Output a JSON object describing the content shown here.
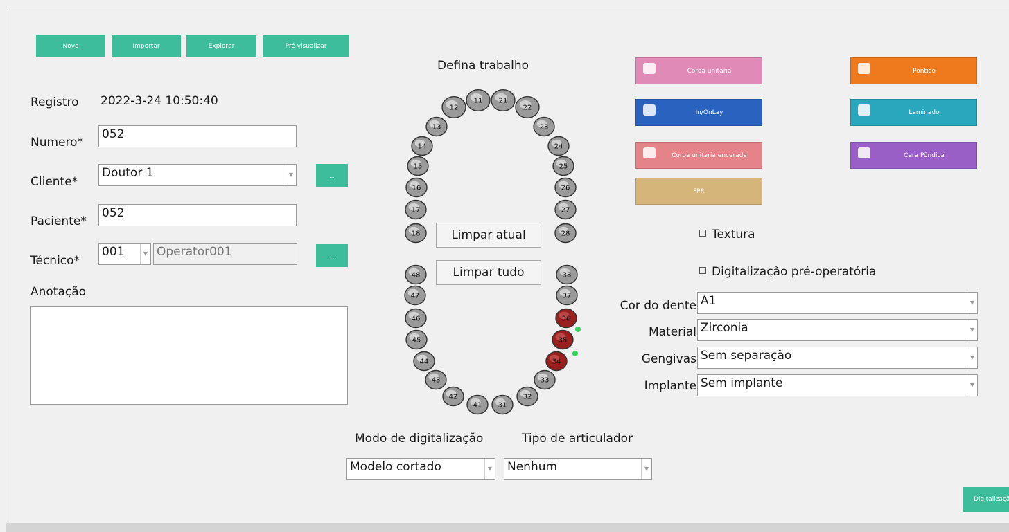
{
  "toolbar": {
    "new_label": "Novo",
    "import_label": "Importar",
    "explore_label": "Explorar",
    "preview_label": "Pré visualizar"
  },
  "form": {
    "registro_label": "Registro",
    "registro_value": "2022-3-24 10:50:40",
    "numero_label": "Numero*",
    "numero_value": "052",
    "cliente_label": "Cliente*",
    "cliente_value": "Doutor 1",
    "paciente_label": "Paciente*",
    "paciente_value": "052",
    "tecnico_label": "Técnico*",
    "tecnico_code": "001",
    "tecnico_name": "Operator001",
    "anotacao_label": "Anotação",
    "ellipsis": "..."
  },
  "teeth_panel": {
    "title": "Defina trabalho",
    "clear_current_label": "Limpar atual",
    "clear_all_label": "Limpar tudo",
    "upper_teeth": [
      "18",
      "17",
      "16",
      "15",
      "14",
      "13",
      "12",
      "11",
      "21",
      "22",
      "23",
      "24",
      "25",
      "26",
      "27",
      "28"
    ],
    "lower_teeth": [
      "48",
      "47",
      "46",
      "45",
      "44",
      "43",
      "42",
      "41",
      "31",
      "32",
      "33",
      "34",
      "35",
      "36",
      "37",
      "38"
    ],
    "selected_teeth": [
      "34",
      "35",
      "36"
    ],
    "selected_color": "#9a2020",
    "normal_color": "#9a9a9a"
  },
  "work_types": [
    {
      "label": "Coroa unitaria",
      "color": "#e08ab8",
      "icon": "crown-icon"
    },
    {
      "label": "Pontico",
      "color": "#ef7a1e",
      "icon": "pontic-icon"
    },
    {
      "label": "In/OnLay",
      "color": "#2a62c0",
      "icon": "inlay-icon"
    },
    {
      "label": "Laminado",
      "color": "#2aa6bd",
      "icon": "veneer-icon"
    },
    {
      "label": "Coroa unitaria encerada",
      "color": "#e58488",
      "icon": "wax-crown-icon"
    },
    {
      "label": "Cera Pôndica",
      "color": "#9a5fc7",
      "icon": "wax-pontic-icon"
    },
    {
      "label": "FPR",
      "color": "#d6b57a",
      "icon": ""
    }
  ],
  "options": {
    "textura_label": "Textura",
    "preop_label": "Digitalização pré-operatória",
    "cor_label": "Cor do dente",
    "cor_value": "A1",
    "material_label": "Material",
    "material_value": "Zirconia",
    "gengivas_label": "Gengivas",
    "gengivas_value": "Sem separação",
    "implante_label": "Implante",
    "implante_value": "Sem implante"
  },
  "scan": {
    "mode_label": "Modo de digitalização",
    "mode_value": "Modelo cortado",
    "articulator_label": "Tipo de articulador",
    "articulator_value": "Nenhum",
    "start_label": "Digitalização"
  }
}
